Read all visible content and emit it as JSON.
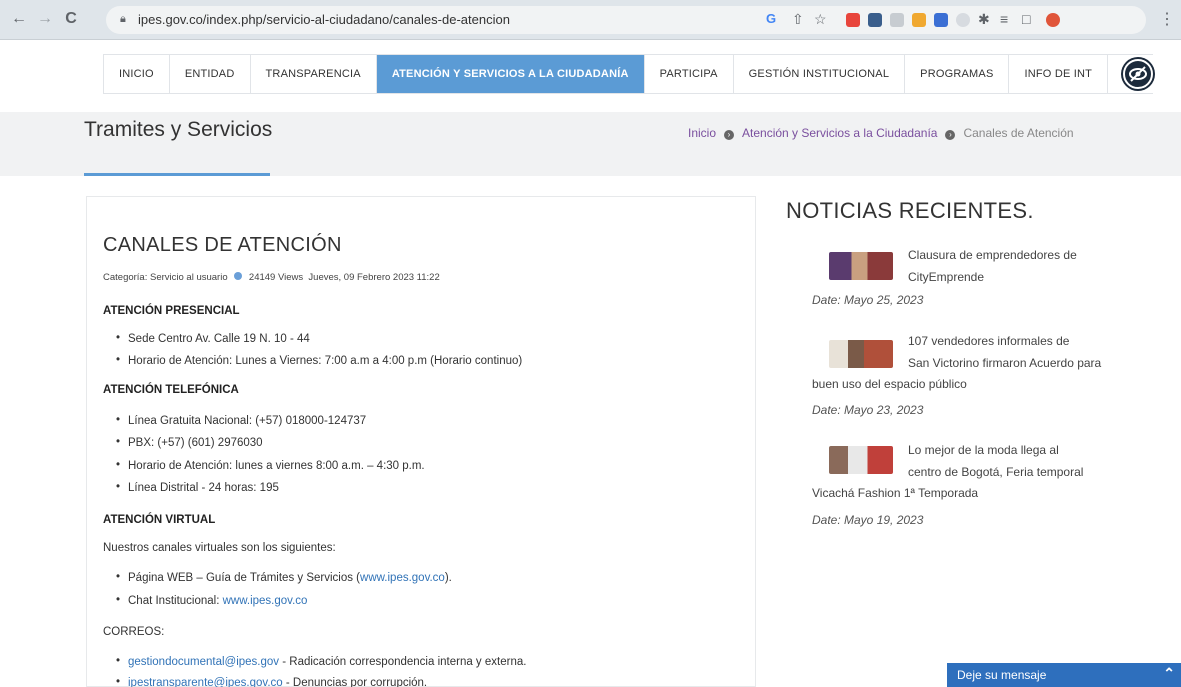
{
  "browser": {
    "url": "ipes.gov.co/index.php/servicio-al-ciudadano/canales-de-atencion"
  },
  "nav": {
    "items": [
      {
        "label": "INICIO"
      },
      {
        "label": "ENTIDAD"
      },
      {
        "label": "TRANSPARENCIA"
      },
      {
        "label": "ATENCIÓN Y SERVICIOS A LA CIUDADANÍA",
        "active": true
      },
      {
        "label": "PARTICIPA"
      },
      {
        "label": "GESTIÓN INSTITUCIONAL"
      },
      {
        "label": "PROGRAMAS"
      },
      {
        "label": "INFO DE INT"
      }
    ]
  },
  "header": {
    "title": "Tramites y Servicios",
    "breadcrumb": [
      "Inicio",
      "Atención y Servicios a la Ciudadanía",
      "Canales de Atención"
    ]
  },
  "article": {
    "title": "CANALES DE ATENCIÓN",
    "category": "Categoría: Servicio al usuario",
    "views": "24149 Views",
    "date": "Jueves, 09 Febrero 2023 11:22",
    "presencial": {
      "heading": "ATENCIÓN PRESENCIAL",
      "items": [
        "Sede Centro Av. Calle 19 N. 10 - 44",
        "Horario de Atención: Lunes a Viernes: 7:00 a.m a 4:00 p.m (Horario continuo)"
      ]
    },
    "telefonica": {
      "heading": "ATENCIÓN TELEFÓNICA",
      "items": [
        "Línea Gratuita Nacional: (+57) 018000-124737",
        "PBX: (+57) (601) 2976030",
        "Horario de Atención: lunes a viernes 8:00 a.m. – 4:30 p.m.",
        "Línea Distrital - 24 horas: 195"
      ]
    },
    "virtual": {
      "heading": "ATENCIÓN VIRTUAL",
      "intro": "Nuestros canales virtuales son los siguientes:",
      "web_prefix": "Página WEB – Guía de Trámites y Servicios (",
      "web_link": "www.ipes.gov.co",
      "web_suffix": ").",
      "chat_prefix": "Chat Institucional: ",
      "chat_link": "www.ipes.gov.co"
    },
    "correos": {
      "heading": "CORREOS:",
      "items": [
        {
          "email": "gestiondocumental@ipes.gov",
          "desc": " - Radicación correspondencia interna y externa."
        },
        {
          "email": "ipestransparente@ipes.gov.co",
          "desc": " - Denuncias por corrupción."
        }
      ]
    }
  },
  "sidebar": {
    "title": "NOTICIAS RECIENTES.",
    "news": [
      {
        "line1": "Clausura de emprendedores de",
        "rest": "CityEmprende",
        "date": "Date: Mayo 25, 2023"
      },
      {
        "line1": "107 vendedores informales de",
        "rest": "San Victorino firmaron Acuerdo para buen uso del espacio público",
        "date": "Date: Mayo 23, 2023"
      },
      {
        "line1": "Lo mejor de la moda llega al",
        "rest": "centro de Bogotá, Feria temporal Vicachá Fashion 1ª Temporada",
        "date": "Date: Mayo 19, 2023"
      }
    ]
  },
  "chat": {
    "label": "Deje su mensaje"
  },
  "colors": {
    "accent": "#5b9bd5",
    "link": "#3173b7",
    "chat": "#2e6fbd"
  }
}
